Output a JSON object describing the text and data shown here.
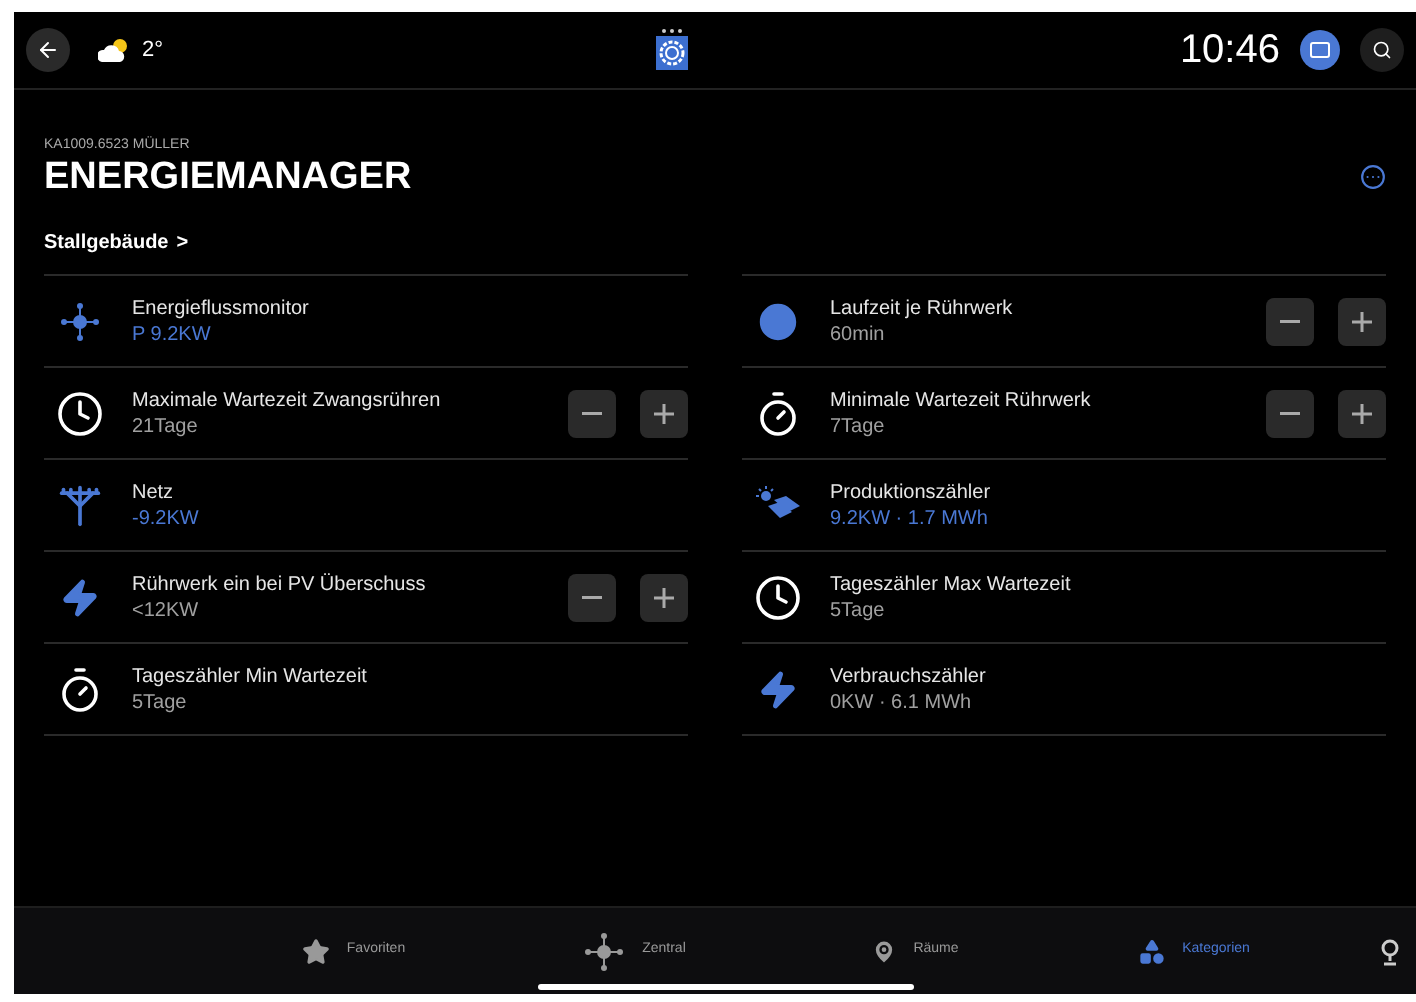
{
  "status_bar": {
    "weather": "2°",
    "time": "10:46"
  },
  "header": {
    "subtitle": "KA1009.6523 MÜLLER",
    "title": "ENERGIEMANAGER",
    "breadcrumb": "Stallgebäude",
    "breadcrumb_arrow": ">"
  },
  "left_items": [
    {
      "kind": "info",
      "label": "Energieflussmonitor",
      "value": "P 9.2KW",
      "accent": true
    },
    {
      "kind": "stepper",
      "label": "Maximale Wartezeit Zwangsrühren",
      "value": "21Tage",
      "accent": false
    },
    {
      "kind": "info",
      "label": "Netz",
      "value": "-9.2KW",
      "accent": true
    },
    {
      "kind": "stepper",
      "label": "Rührwerk ein bei PV Überschuss",
      "value": "<12KW",
      "accent": false
    },
    {
      "kind": "info",
      "label": "Tageszähler Min Wartezeit",
      "value": "5Tage",
      "accent": false
    }
  ],
  "right_items": [
    {
      "kind": "stepper",
      "label": "Laufzeit je Rührwerk",
      "value": "60min",
      "accent": false
    },
    {
      "kind": "stepper",
      "label": "Minimale Wartezeit Rührwerk",
      "value": "7Tage",
      "accent": false
    },
    {
      "kind": "info",
      "label": "Produktionszähler",
      "value": "9.2KW · 1.7 MWh",
      "accent": true
    },
    {
      "kind": "info",
      "label": "Tageszähler Max Wartezeit",
      "value": "5Tage",
      "accent": false
    },
    {
      "kind": "info",
      "label": "Verbrauchszähler",
      "value": "0KW · 6.1 MWh",
      "accent": false
    }
  ],
  "bottom_nav": [
    {
      "label": "Favoriten",
      "selected": false
    },
    {
      "label": "Zentral",
      "selected": false
    },
    {
      "label": "Räume",
      "selected": false
    },
    {
      "label": "Kategorien",
      "selected": true
    }
  ]
}
